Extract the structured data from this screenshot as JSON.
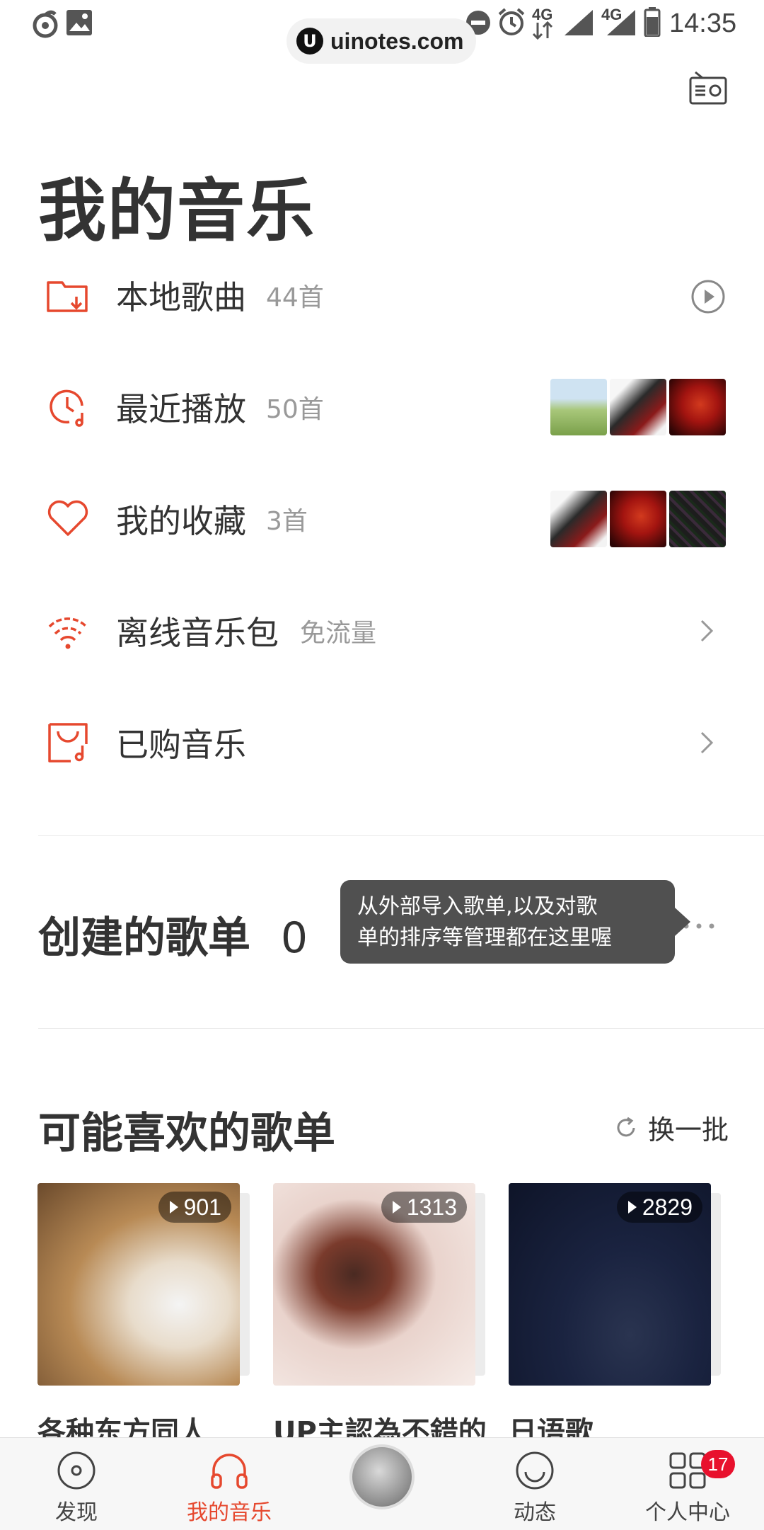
{
  "status_bar": {
    "time": "14:35",
    "network_1": "4G",
    "network_2": "4G"
  },
  "watermark": {
    "text": "uinotes.com",
    "logo": "U"
  },
  "header": {
    "radio_icon": "radio-icon"
  },
  "page_title": "我的音乐",
  "rows": [
    {
      "label": "本地歌曲",
      "count": "44首",
      "icon": "folder-download-icon",
      "action": "play-circle-icon"
    },
    {
      "label": "最近播放",
      "count": "50首",
      "icon": "clock-music-icon"
    },
    {
      "label": "我的收藏",
      "count": "3首",
      "icon": "heart-icon"
    },
    {
      "label": "离线音乐包",
      "count": "免流量",
      "icon": "wifi-icon",
      "action": "chevron-right-icon"
    },
    {
      "label": "已购音乐",
      "count": "",
      "icon": "bag-music-icon",
      "action": "chevron-right-icon"
    }
  ],
  "created_playlists": {
    "title": "创建的歌单",
    "count": "0",
    "more_icon": "more-dots-icon"
  },
  "tooltip": {
    "line1": "从外部导入歌单,以及对歌",
    "line2": "单的排序等管理都在这里喔"
  },
  "recommended": {
    "title": "可能喜欢的歌单",
    "refresh_label": "换一批",
    "cards": [
      {
        "plays": "901",
        "title": "各种东方同人"
      },
      {
        "plays": "1313",
        "title": "UP主認為不錯的"
      },
      {
        "plays": "2829",
        "title": "日语歌"
      }
    ]
  },
  "tabs": [
    {
      "label": "发现",
      "icon": "disc-icon",
      "active": false
    },
    {
      "label": "我的音乐",
      "icon": "headphones-icon",
      "active": true
    },
    {
      "label": "",
      "icon": "now-playing-disc",
      "active": false
    },
    {
      "label": "动态",
      "icon": "smile-icon",
      "active": false
    },
    {
      "label": "个人中心",
      "icon": "grid-icon",
      "active": false,
      "badge": "17"
    }
  ],
  "colors": {
    "accent": "#e6482e",
    "badge": "#e8112d",
    "text": "#333333",
    "muted": "#999999"
  }
}
